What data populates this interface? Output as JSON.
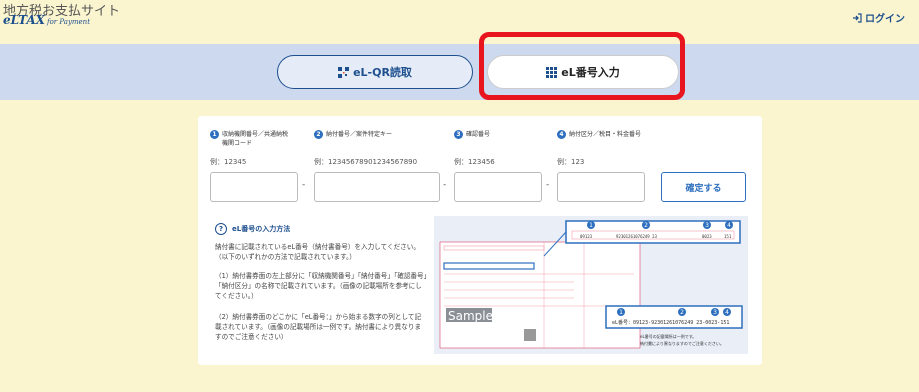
{
  "header": {
    "site_title": "地方税お支払サイト",
    "logo_main": "eLTAX",
    "logo_sub": "for Payment",
    "login_label": "ログイン"
  },
  "tabs": {
    "qr_label": "eL-QR読取",
    "number_label": "eL番号入力"
  },
  "form": {
    "fields": [
      {
        "badge": "1",
        "label": "収納機関番号／共通納税機関コード",
        "example": "例：12345"
      },
      {
        "badge": "2",
        "label": "納付番号／案件特定キー",
        "example": "例：12345678901234567890"
      },
      {
        "badge": "3",
        "label": "確認番号",
        "example": "例：123456"
      },
      {
        "badge": "4",
        "label": "納付区分／税目・料金番号",
        "example": "例：123"
      }
    ],
    "separator": "-",
    "confirm_label": "確定する"
  },
  "help": {
    "title": "eL番号の入力方法",
    "p1": "納付書に記載されているeL番号（納付書番号）を入力してください。（以下のいずれかの方法で記載されています。）",
    "p2": "（1）納付書券面の左上部分に「収納機関番号」「納付番号」「確認番号」「納付区分」の名称で記載されています。（画像の記載場所を参考にしてください。）",
    "p3": "（2）納付書券面のどこかに「eL番号：」から始まる数字の列として記載されています。（画像の記載場所は一例です。納付書により異なりますのでご注意ください）"
  },
  "sample": {
    "top_values": [
      "09123",
      "92301261076249 23",
      "0023",
      "151"
    ],
    "el_line": "eL番号：09123-92301261076249 23-0023-151",
    "watermark": "Sample",
    "note1": "eL番号の記載場所は一例です。",
    "note2": "納付書により異なりますのでご注意ください。"
  }
}
